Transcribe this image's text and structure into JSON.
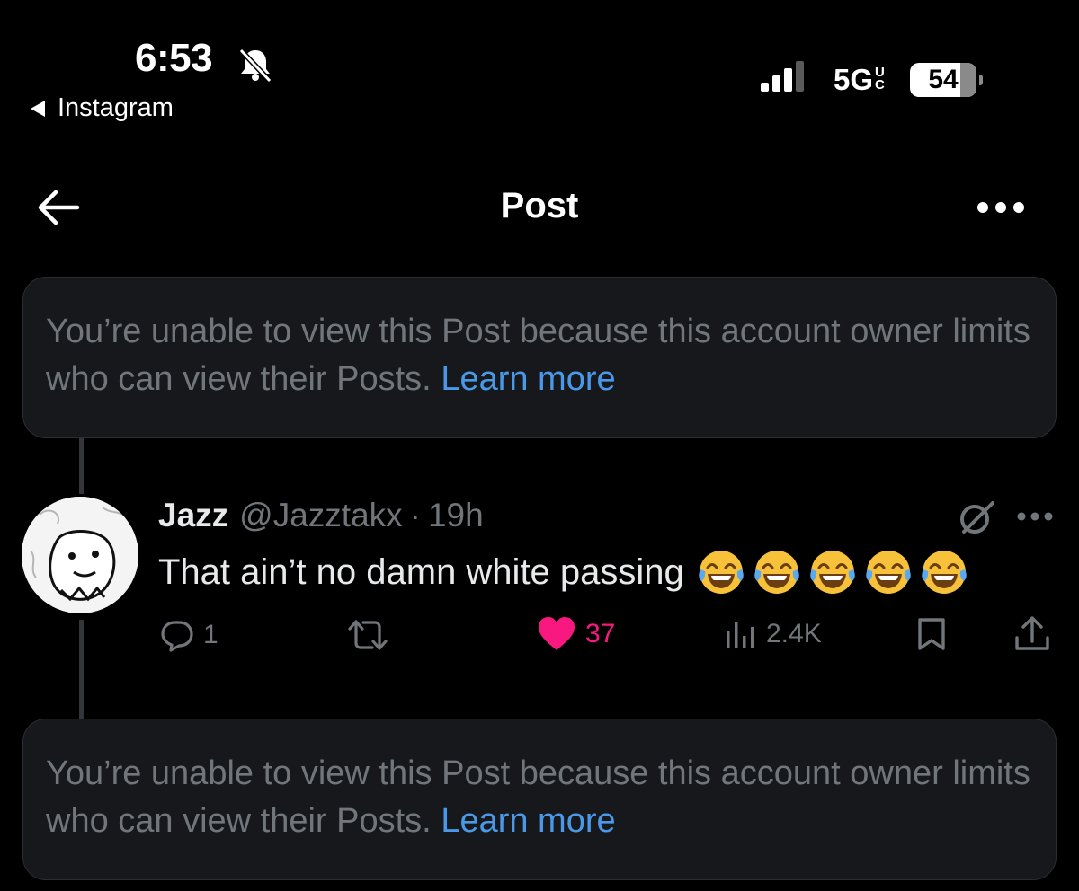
{
  "status_bar": {
    "time": "6:53",
    "back_app": "Instagram",
    "network": "5G",
    "network_sup_top": "U",
    "network_sup_bottom": "C",
    "battery": "54"
  },
  "nav": {
    "title": "Post"
  },
  "notice_top": {
    "text": "You’re unable to view this Post because this account owner limits who can view their Posts. ",
    "link": "Learn more"
  },
  "reply": {
    "display_name": "Jazz",
    "handle": "@Jazztakx",
    "separator": "·",
    "time": "19h",
    "text": "That ain’t no damn white passing",
    "emoji_count": 5,
    "actions": {
      "replies": "1",
      "likes": "37",
      "views": "2.4K"
    }
  },
  "notice_bottom": {
    "text": "You’re unable to view this Post because this account owner limits who can view their Posts. ",
    "link": "Learn more"
  },
  "colors": {
    "background": "#000000",
    "card": "#16181c",
    "muted": "#71767b",
    "link": "#4a99e9",
    "like": "#f91880"
  }
}
